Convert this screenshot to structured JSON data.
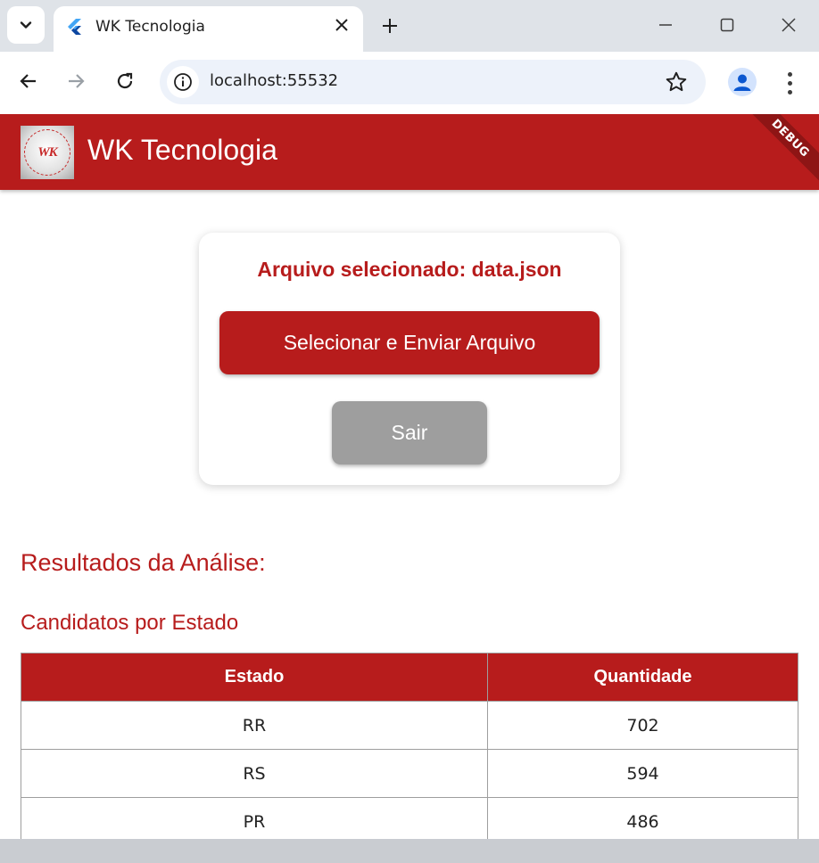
{
  "browser": {
    "tab_title": "WK Tecnologia",
    "url": "localhost:55532"
  },
  "app": {
    "title": "WK Tecnologia",
    "logo_text": "WK",
    "debug_label": "DEBUG",
    "selected_file": "Arquivo selecionado: data.json",
    "upload_button": "Selecionar e Enviar Arquivo",
    "exit_button": "Sair",
    "results_title": "Resultados da Análise:",
    "section_title": "Candidatos por Estado"
  },
  "table": {
    "headers": [
      "Estado",
      "Quantidade"
    ],
    "rows": [
      [
        "RR",
        "702"
      ],
      [
        "RS",
        "594"
      ],
      [
        "PR",
        "486"
      ]
    ]
  },
  "colors": {
    "primary": "#b71c1c",
    "exit_button": "#9e9e9e"
  }
}
